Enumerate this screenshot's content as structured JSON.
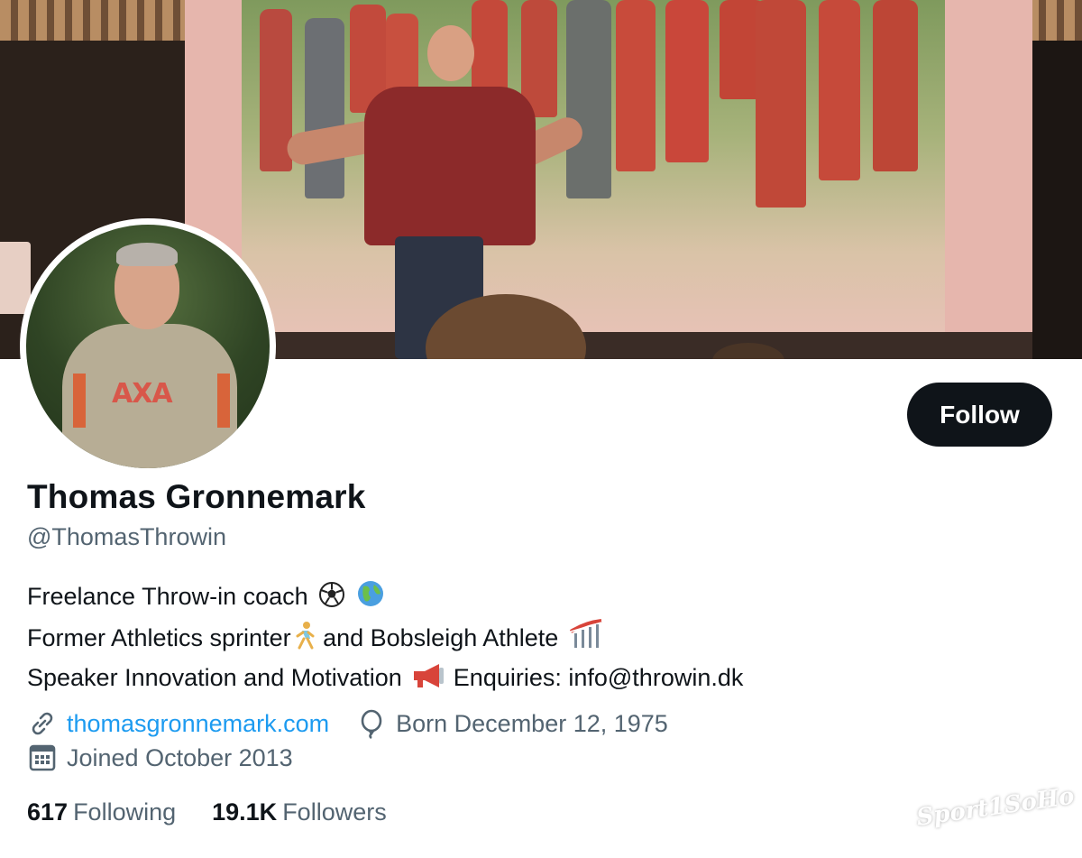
{
  "profile": {
    "name": "Thomas Gronnemark",
    "handle": "@ThomasThrowin",
    "follow_label": "Follow",
    "bio": {
      "line1": "Freelance Throw-in coach",
      "line2a": "Former Athletics sprinter",
      "line2b": " and Bobsleigh Athlete",
      "line3a": "Speaker Innovation and Motivation",
      "line3b": " Enquiries: info@throwin.dk"
    },
    "website": "thomasgronnemark.com",
    "birthday": "Born December 12, 1975",
    "joined": "Joined October 2013",
    "following_count": "617",
    "following_label": "Following",
    "followers_count": "19.1K",
    "followers_label": "Followers"
  },
  "icons": {
    "website": "link-icon",
    "birthday": "balloon-icon",
    "joined": "calendar-icon",
    "bio_line1": [
      "soccer-ball-icon",
      "globe-icon"
    ],
    "bio_line2": [
      "runner-icon",
      "bobsled-icon"
    ],
    "bio_line3": [
      "megaphone-icon"
    ]
  },
  "colors": {
    "text_primary": "#0f1419",
    "text_secondary": "#536471",
    "link": "#1d9bf0",
    "button_bg": "#0f1419",
    "button_text": "#ffffff"
  },
  "watermark": "Sport1SoHo"
}
